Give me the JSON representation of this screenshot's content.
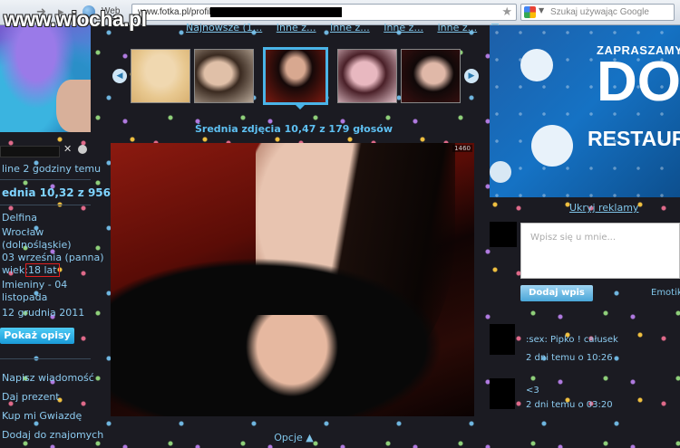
{
  "browser": {
    "web_label": "Web",
    "address": "www.fotka.pl/profil/",
    "search_placeholder": "Szukaj używając Google"
  },
  "watermark": "www.wiocha.pl",
  "left": {
    "online": "line 2 godziny temu",
    "rating": "ednia 10,32 z 956",
    "name": "Delfina",
    "city": "Wrocław",
    "region": "(dolnośląskie)",
    "birthday": "03 września (panna)",
    "age_label": "wiek:",
    "age": "18 lat",
    "nameday": "Imieniny - 04",
    "nameday2": "listopada",
    "joined": "12 grudnia 2011",
    "show_desc": "Pokaż opisy",
    "links": {
      "message": "Napisz wiadomość",
      "gift": "Daj prezent",
      "star": "Kup mi Gwiazdę",
      "friends": "Dodaj do znajomych"
    }
  },
  "center": {
    "tabs": [
      "Najnowsze (1...",
      "Inne z...",
      "Inne z...",
      "Inne z...",
      "Inne z..."
    ],
    "photo_rating": "Średnia zdjęcia 10,47 z 179 głosów",
    "photo_counter": "1460",
    "options": "Opcje ▲"
  },
  "right": {
    "ad": {
      "line1": "ZAPRASZAMY",
      "line2": "DO",
      "line3": "RESTAURACJI"
    },
    "hide_ads": "Ukryj reklamy",
    "comment_placeholder": "Wpisz się u mnie...",
    "add_post": "Dodaj wpis",
    "emoticons": "Emotik",
    "posts": [
      {
        "text": ":sex: Pipko ! całusek",
        "time": "2 dni temu o 10:26"
      },
      {
        "text": "<3",
        "time": "2 dni temu o 03:20"
      }
    ]
  }
}
